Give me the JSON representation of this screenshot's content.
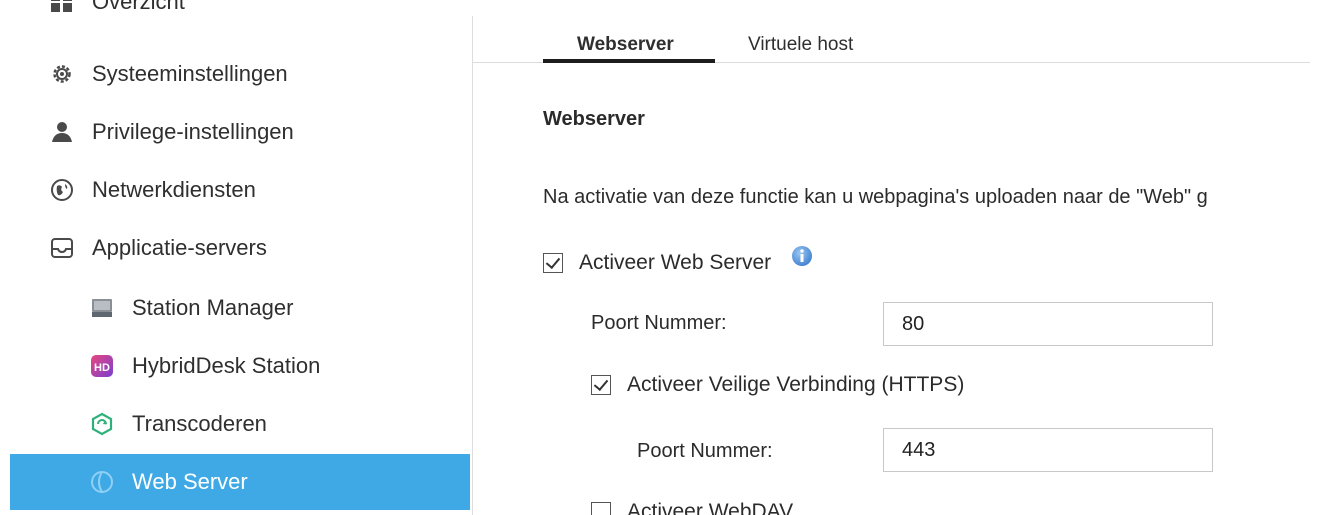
{
  "sidebar": {
    "items": [
      {
        "label": "Overzicht",
        "icon": "grid-icon"
      },
      {
        "label": "Systeeminstellingen",
        "icon": "gear-icon"
      },
      {
        "label": "Privilege-instellingen",
        "icon": "user-icon"
      },
      {
        "label": "Netwerkdiensten",
        "icon": "globe-icon"
      },
      {
        "label": "Applicatie-servers",
        "icon": "tray-icon"
      }
    ],
    "subitems": [
      {
        "label": "Station Manager",
        "icon": "station-manager-icon"
      },
      {
        "label": "HybridDesk Station",
        "icon": "hybriddesk-icon",
        "badge": "HD"
      },
      {
        "label": "Transcoderen",
        "icon": "transcode-icon"
      },
      {
        "label": "Web Server",
        "icon": "web-server-icon",
        "active": true
      }
    ],
    "active_color": "#3fa9e6"
  },
  "tabs": [
    {
      "label": "Webserver",
      "active": true
    },
    {
      "label": "Virtuele host",
      "active": false
    }
  ],
  "section": {
    "title": "Webserver",
    "description": "Na activatie van deze functie kan u webpagina's uploaden naar de \"Web\" g"
  },
  "web_server": {
    "label": "Activeer Web Server",
    "checked": true,
    "port_label": "Poort Nummer:",
    "port_value": "80"
  },
  "https": {
    "label": "Activeer Veilige Verbinding (HTTPS)",
    "checked": true,
    "port_label": "Poort Nummer:",
    "port_value": "443"
  },
  "webdav": {
    "label": "Activeer WebDAV",
    "checked": false
  }
}
